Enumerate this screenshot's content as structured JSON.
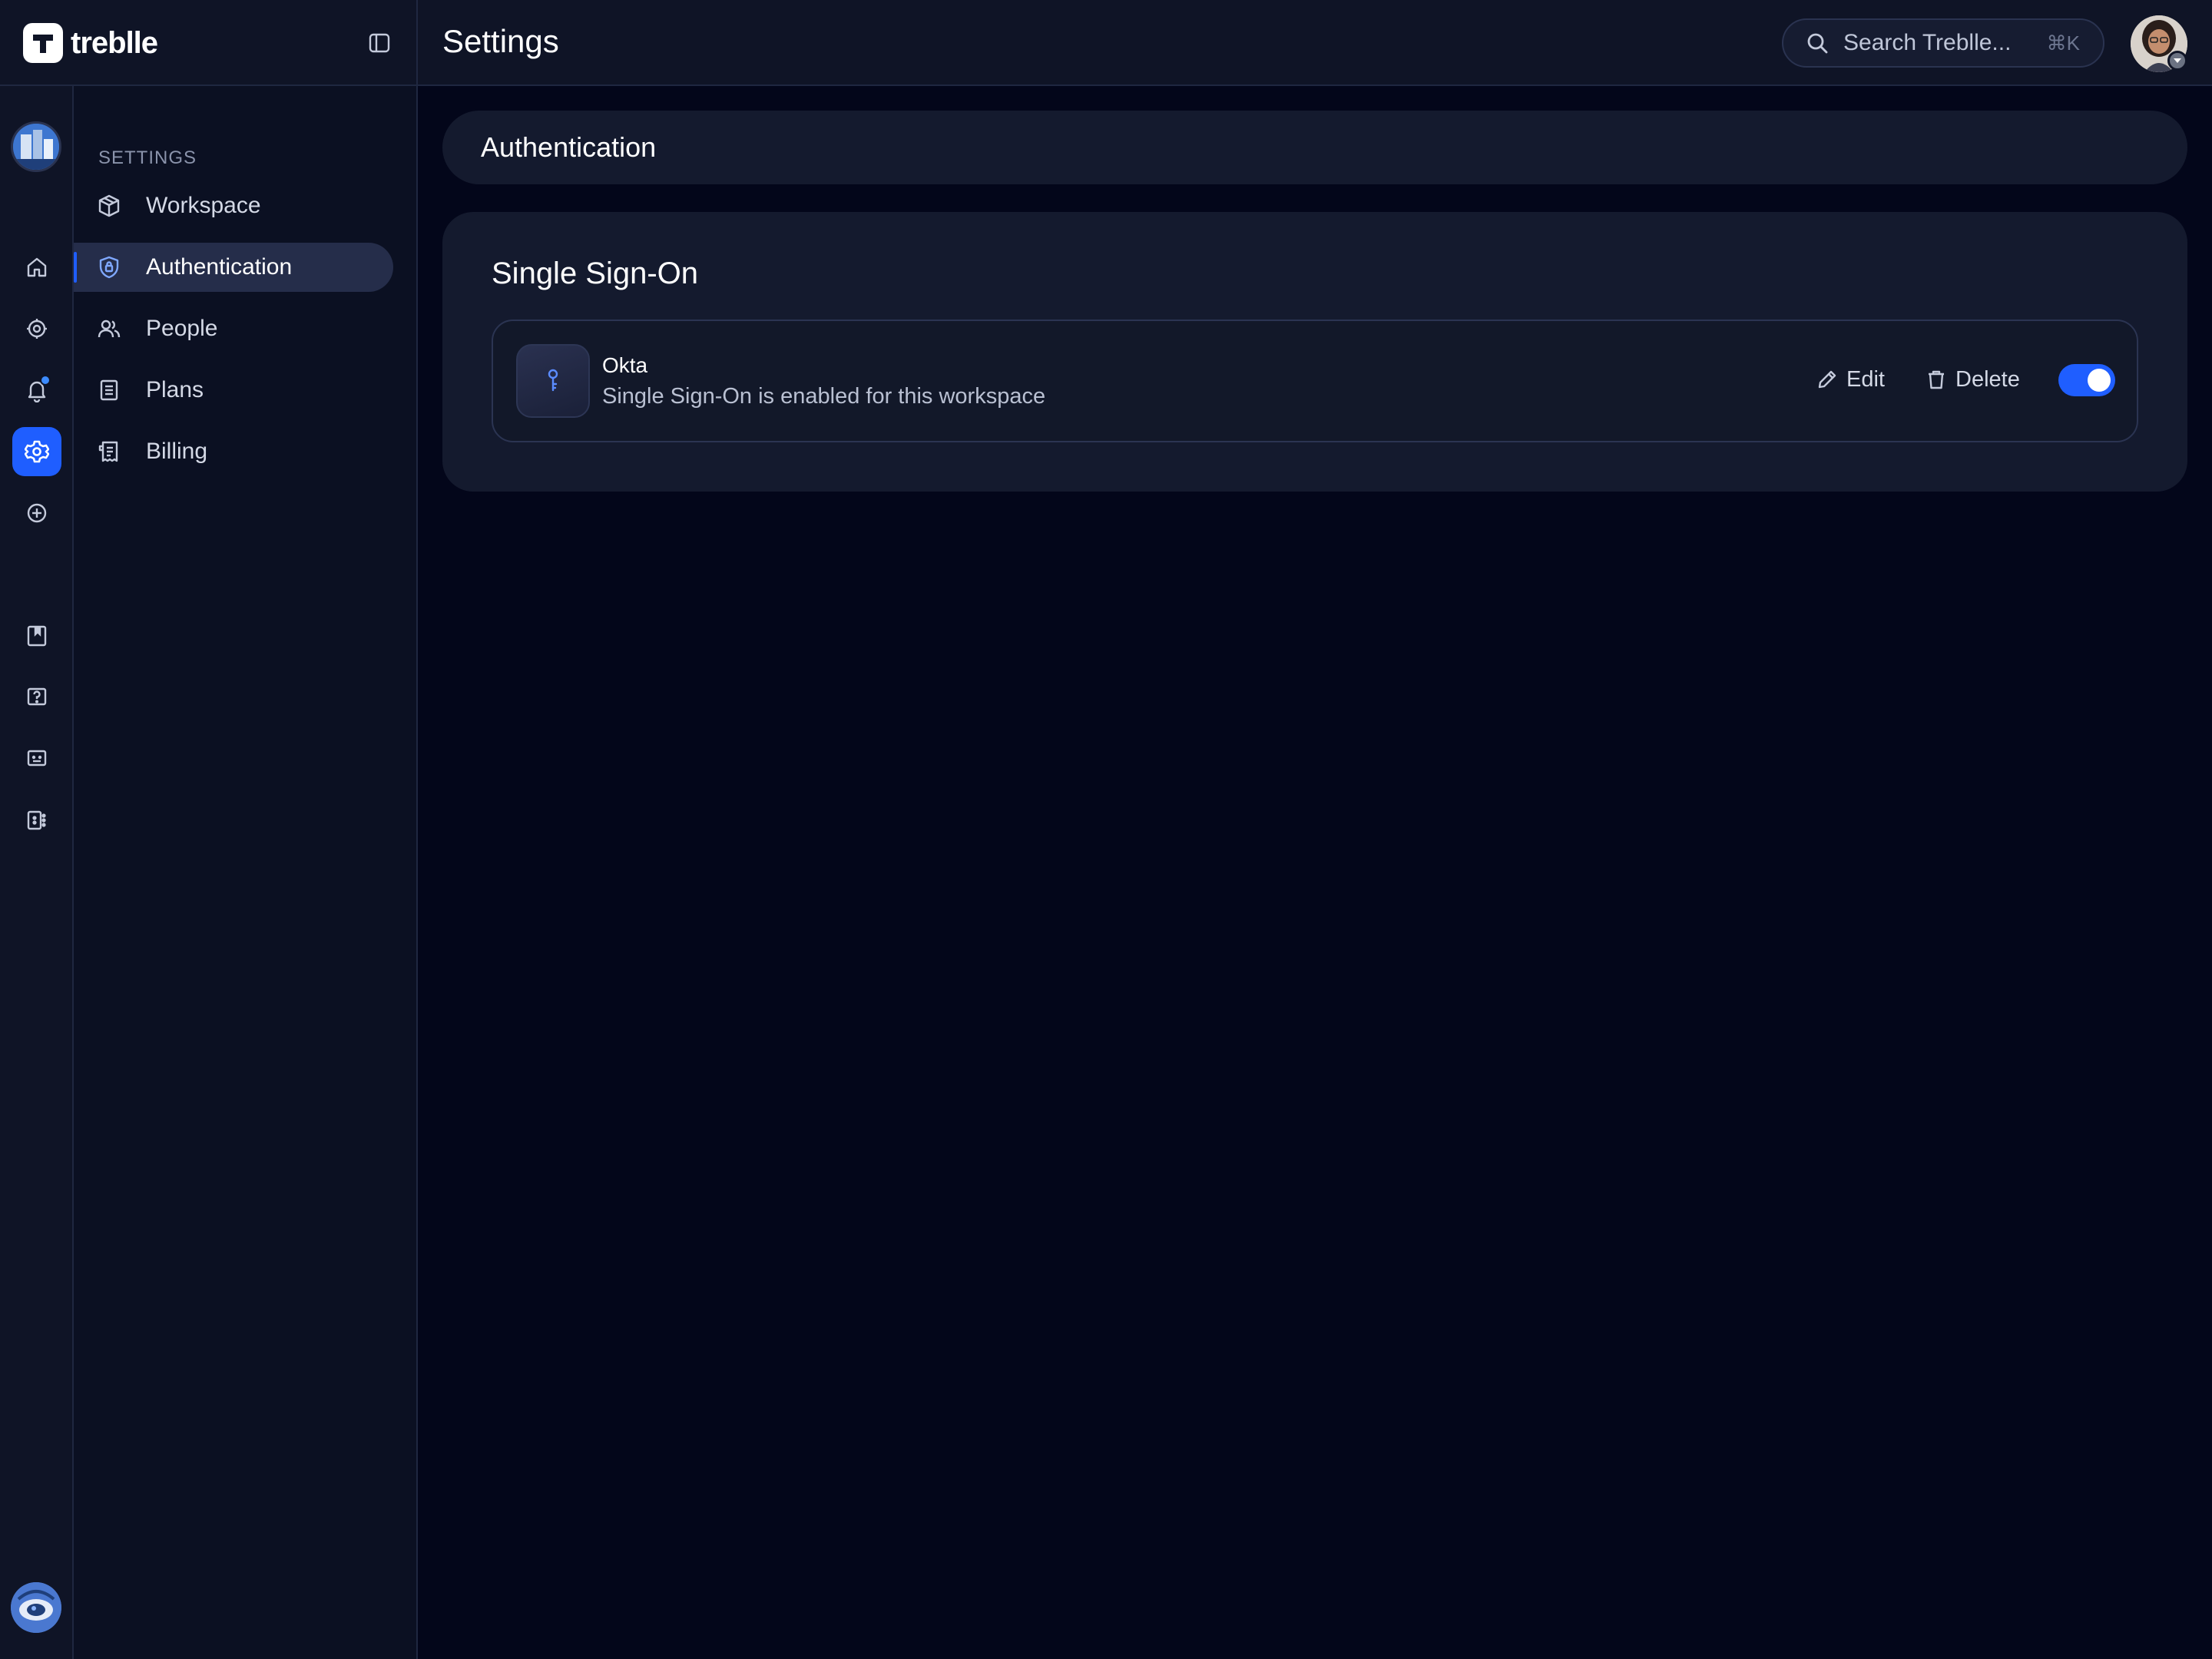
{
  "brand": {
    "name": "treblle"
  },
  "header": {
    "title": "Settings",
    "search": {
      "placeholder": "Search Treblle...",
      "shortcut": "⌘K"
    }
  },
  "rail": {
    "items": [
      {
        "icon": "home-icon"
      },
      {
        "icon": "api-gear-icon"
      },
      {
        "icon": "bell-icon",
        "has_notification": true
      },
      {
        "icon": "settings-icon",
        "active": true
      },
      {
        "icon": "plus-circle-icon"
      },
      {
        "icon": "bookmark-icon"
      },
      {
        "icon": "help-icon"
      },
      {
        "icon": "chat-icon"
      },
      {
        "icon": "apps-icon"
      }
    ]
  },
  "sidebar": {
    "heading": "SETTINGS",
    "items": [
      {
        "label": "Workspace",
        "icon": "cube-icon"
      },
      {
        "label": "Authentication",
        "icon": "shield-lock-icon",
        "active": true
      },
      {
        "label": "People",
        "icon": "users-icon"
      },
      {
        "label": "Plans",
        "icon": "document-icon"
      },
      {
        "label": "Billing",
        "icon": "receipt-icon"
      }
    ]
  },
  "main": {
    "section_title": "Authentication",
    "card": {
      "title": "Single Sign-On",
      "provider": {
        "name": "Okta",
        "description": "Single Sign-On is enabled for this workspace",
        "icon": "key-icon",
        "edit_label": "Edit",
        "delete_label": "Delete",
        "enabled": true
      }
    }
  },
  "colors": {
    "accent": "#1f5eff",
    "background": "#03061a",
    "panel": "#141a2e"
  }
}
